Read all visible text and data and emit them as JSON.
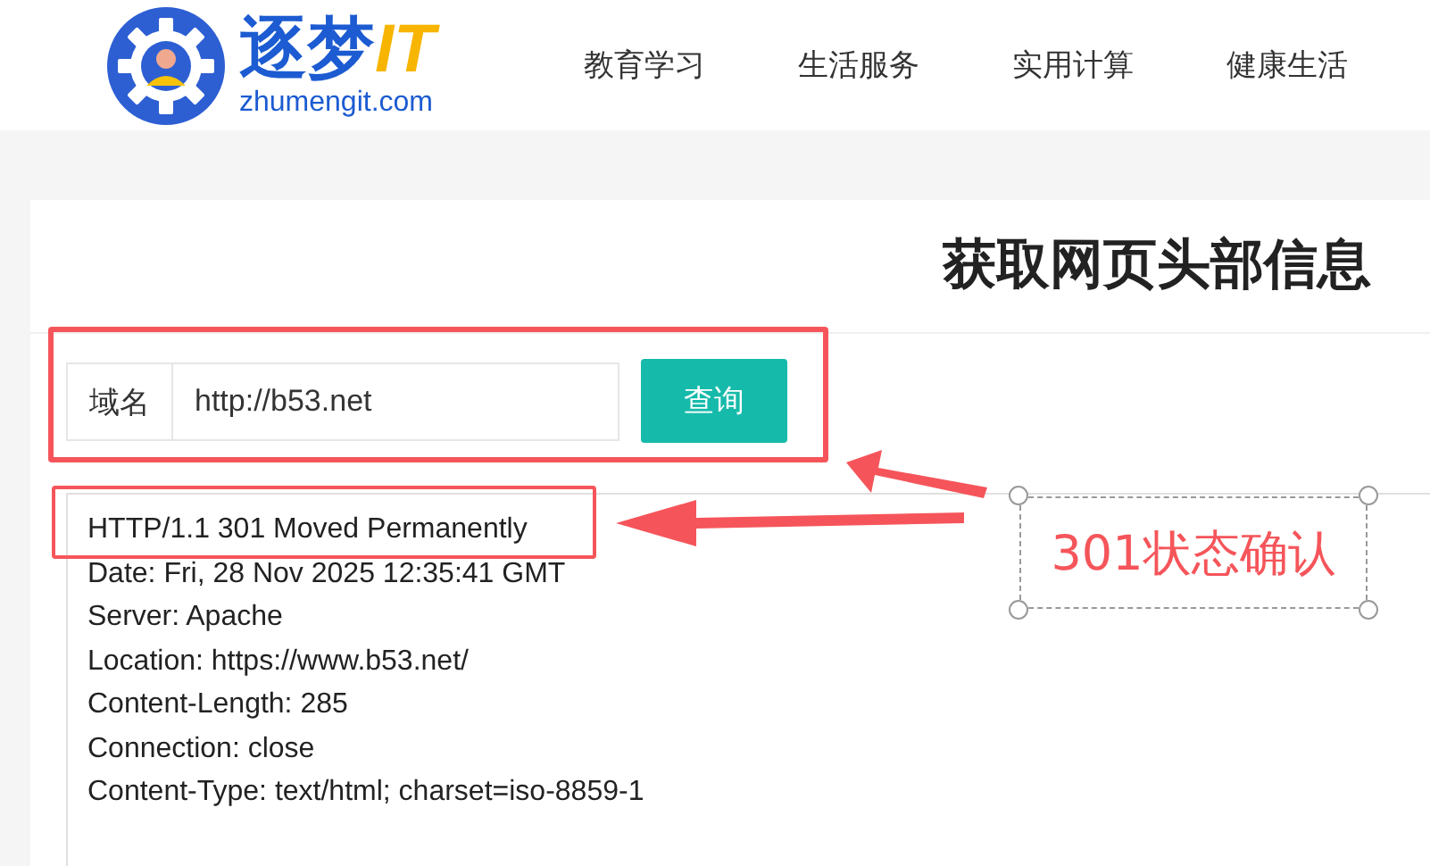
{
  "header": {
    "logo": {
      "name": "逐梦",
      "suffix": "IT",
      "domain": "zhumengit.com"
    },
    "nav": [
      {
        "label": "教育学习"
      },
      {
        "label": "生活服务"
      },
      {
        "label": "实用计算"
      },
      {
        "label": "健康生活"
      }
    ]
  },
  "page": {
    "title": "获取网页头部信息",
    "form": {
      "label": "域名",
      "value": "http://b53.net",
      "button": "查询"
    },
    "response": [
      "HTTP/1.1 301 Moved Permanently",
      "Date: Fri, 28 Nov 2025 12:35:41 GMT",
      "Server: Apache",
      "Location: https://www.b53.net/",
      "Content-Length: 285",
      "Connection: close",
      "Content-Type: text/html; charset=iso-8859-1"
    ]
  },
  "annotation": {
    "note": "301状态确认"
  }
}
